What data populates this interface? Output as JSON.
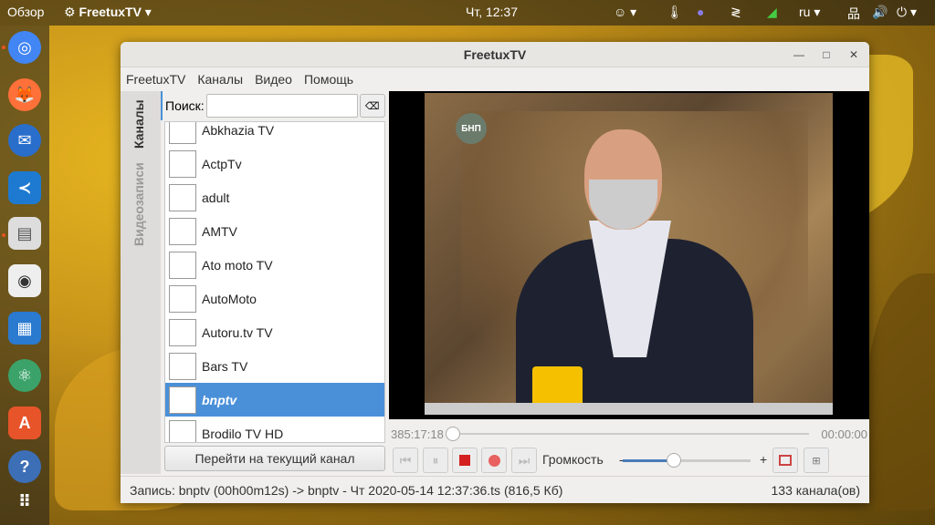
{
  "topbar": {
    "activities": "Обзор",
    "app": "FreetuxTV",
    "clock": "Чт, 12:37",
    "lang": "ru"
  },
  "dock": {
    "items": [
      "chromium",
      "firefox",
      "thunderbird",
      "vscode",
      "files",
      "rhythmbox",
      "writer",
      "atom",
      "software",
      "help",
      "apps-grid"
    ]
  },
  "window": {
    "title": "FreetuxTV"
  },
  "menu": [
    "FreetuxTV",
    "Каналы",
    "Видео",
    "Помощь"
  ],
  "tabs": {
    "channels": "Каналы",
    "recordings": "Видеозаписи"
  },
  "search": {
    "label": "Поиск:",
    "value": ""
  },
  "channels": [
    {
      "name": "Abkhazia TV"
    },
    {
      "name": "ActpTv"
    },
    {
      "name": "adult"
    },
    {
      "name": "AMTV"
    },
    {
      "name": "Ato moto TV"
    },
    {
      "name": "AutoMoto"
    },
    {
      "name": "Autoru.tv TV"
    },
    {
      "name": "Bars TV"
    },
    {
      "name": "bnptv",
      "selected": true
    },
    {
      "name": "Brodilo TV HD"
    }
  ],
  "goto_button": "Перейти на текущий канал",
  "video": {
    "logo": "БНП"
  },
  "player": {
    "elapsed": "385:17:18",
    "total": "00:00:00",
    "seek_fraction": 0,
    "volume_label": "Громкость",
    "minus": "-",
    "plus": "+",
    "volume_fraction": 0.4
  },
  "status": {
    "recording": "Запись: bnptv (00h00m12s) -> bnptv - Чт 2020-05-14 12:37:36.ts (816,5 Кб)",
    "count": "133 канала(ов)"
  },
  "colors": {
    "accent": "#4a90d9",
    "record": "#d42020"
  }
}
